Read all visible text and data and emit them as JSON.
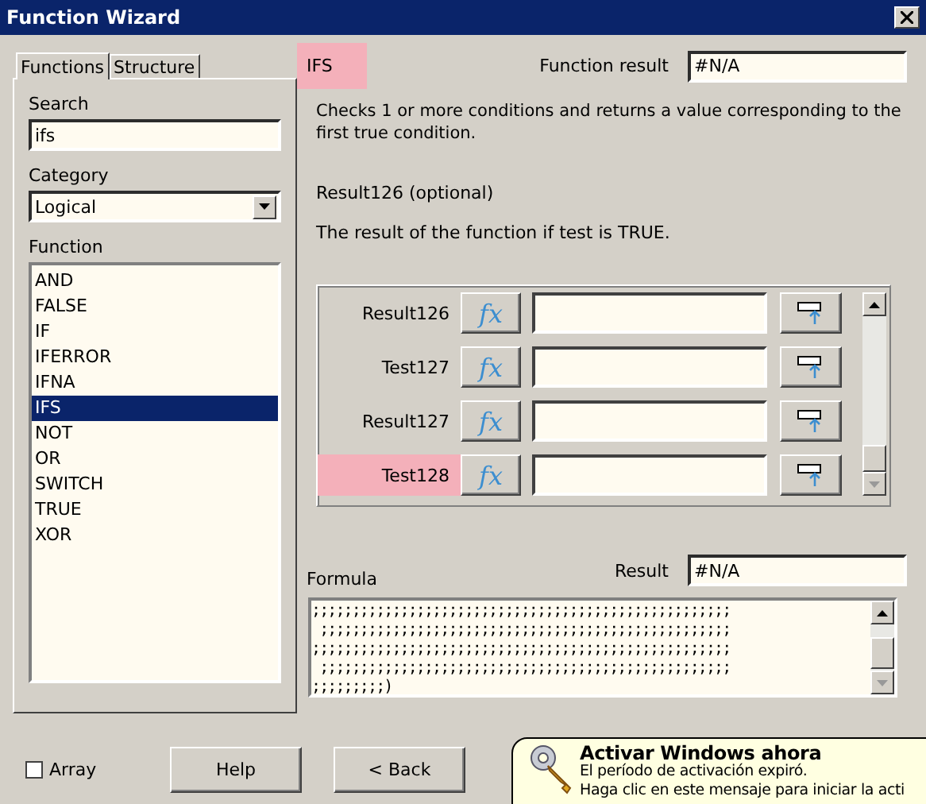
{
  "window": {
    "title": "Function Wizard"
  },
  "tabs": [
    {
      "label": "Functions",
      "selected": true
    },
    {
      "label": "Structure",
      "selected": false
    }
  ],
  "search": {
    "label": "Search",
    "value": "ifs"
  },
  "category": {
    "label": "Category",
    "value": "Logical"
  },
  "functions": {
    "label": "Function",
    "items": [
      {
        "label": "AND",
        "selected": false
      },
      {
        "label": "FALSE",
        "selected": false
      },
      {
        "label": "IF",
        "selected": false
      },
      {
        "label": "IFERROR",
        "selected": false
      },
      {
        "label": "IFNA",
        "selected": false
      },
      {
        "label": "IFS",
        "selected": true
      },
      {
        "label": "NOT",
        "selected": false
      },
      {
        "label": "OR",
        "selected": false
      },
      {
        "label": "SWITCH",
        "selected": false
      },
      {
        "label": "TRUE",
        "selected": false
      },
      {
        "label": "XOR",
        "selected": false
      }
    ]
  },
  "function_name": {
    "text": "IFS",
    "highlighted": true
  },
  "function_result": {
    "label": "Function result",
    "value": "#N/A"
  },
  "description": "Checks 1 or more conditions and returns a value corresponding to the first true condition.",
  "argument_title": "Result126 (optional)",
  "argument_description": "The result of the function if test is TRUE.",
  "arguments": [
    {
      "label": "Result126",
      "fx": "fx",
      "highlighted": false
    },
    {
      "label": "Test127",
      "fx": "fx",
      "highlighted": false
    },
    {
      "label": "Result127",
      "fx": "fx",
      "highlighted": false
    },
    {
      "label": "Test128",
      "fx": "fx",
      "highlighted": true
    }
  ],
  "formula": {
    "label": "Formula",
    "lines": [
      ";;;;;;;;;;;;;;;;;;;;;;;;;;;;;;;;;;;;;;;;;;;;;;;;;;;;",
      " ;;;;;;;;;;;;;;;;;;;;;;;;;;;;;;;;;;;;;;;;;;;;;;;;;;;",
      ";;;;;;;;;;;;;;;;;;;;;;;;;;;;;;;;;;;;;;;;;;;;;;;;;;;;",
      " ;;;;;;;;;;;;;;;;;;;;;;;;;;;;;;;;;;;;;;;;;;;;;;;;;;;",
      ";;;;;;;;;)"
    ]
  },
  "result": {
    "label": "Result",
    "value": "#N/A"
  },
  "array": {
    "label": "Array",
    "checked": false
  },
  "buttons": [
    "Help",
    "< Back"
  ],
  "notification": {
    "title": "Activar Windows ahora",
    "lines": [
      "El período de activación expiró.",
      "Haga clic en este mensaje para iniciar la acti"
    ]
  }
}
